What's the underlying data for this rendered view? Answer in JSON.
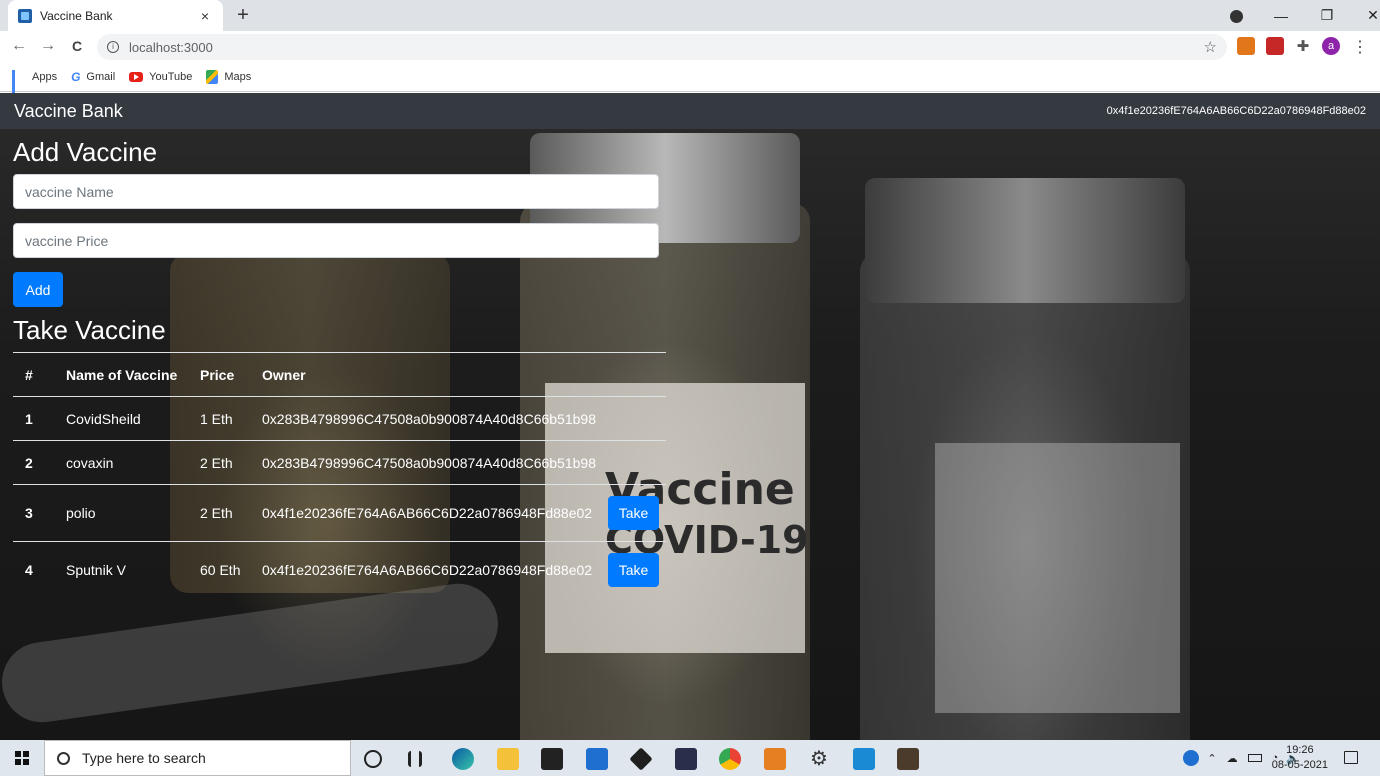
{
  "browser": {
    "tab_title": "Vaccine Bank",
    "tab_close": "×",
    "new_tab": "+",
    "url": "localhost:3000",
    "back": "←",
    "forward": "→",
    "reload": "C",
    "star": "☆",
    "profile_initial": "a",
    "menu": "⋮",
    "win_minimize": "—",
    "win_restore": "❐",
    "win_close": "✕",
    "bookmarks": [
      {
        "label": "Apps",
        "icon": "apps-grid-icon"
      },
      {
        "label": "Gmail",
        "icon": "google-icon"
      },
      {
        "label": "YouTube",
        "icon": "youtube-icon"
      },
      {
        "label": "Maps",
        "icon": "maps-icon"
      }
    ]
  },
  "app": {
    "brand": "Vaccine Bank",
    "account": "0x4f1e20236fE764A6AB66C6D22a0786948Fd88e02",
    "add_section": {
      "title": "Add Vaccine",
      "name_placeholder": "vaccine Name",
      "price_placeholder": "vaccine Price",
      "add_label": "Add"
    },
    "take_section": {
      "title": "Take Vaccine",
      "headers": [
        "#",
        "Name of Vaccine",
        "Price",
        "Owner"
      ],
      "rows": [
        {
          "num": "1",
          "name": "CovidSheild",
          "price": "1 Eth",
          "owner": "0x283B4798996C47508a0b900874A40d8C66b51b98",
          "action": ""
        },
        {
          "num": "2",
          "name": "covaxin",
          "price": "2 Eth",
          "owner": "0x283B4798996C47508a0b900874A40d8C66b51b98",
          "action": ""
        },
        {
          "num": "3",
          "name": "polio",
          "price": "2 Eth",
          "owner": "0x4f1e20236fE764A6AB66C6D22a0786948Fd88e02",
          "action": "Take"
        },
        {
          "num": "4",
          "name": "Sputnik V",
          "price": "60 Eth",
          "owner": "0x4f1e20236fE764A6AB66C6D22a0786948Fd88e02",
          "action": "Take"
        }
      ]
    },
    "background_label_1": "Vaccine",
    "background_label_2": "COVID-19"
  },
  "taskbar": {
    "search_placeholder": "Type here to search",
    "time": "19:26",
    "date": "08-05-2021",
    "colors": {
      "accent": "#007bff",
      "navbar": "#343a40"
    }
  }
}
